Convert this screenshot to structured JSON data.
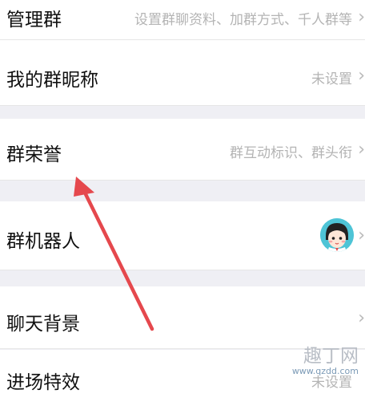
{
  "rows": {
    "manage": {
      "title": "管理群",
      "value": "设置群聊资料、加群方式、千人群等"
    },
    "nickname": {
      "title": "我的群昵称",
      "value": "未设置"
    },
    "honor": {
      "title": "群荣誉",
      "value": "群互动标识、群头衔"
    },
    "robot": {
      "title": "群机器人"
    },
    "background": {
      "title": "聊天背景"
    },
    "next": {
      "title": "进场特效",
      "value": "未设置"
    }
  },
  "icons": {
    "chevron": "›",
    "avatar": "robot-avatar-icon"
  },
  "watermark": {
    "text": "趣丁网",
    "url": "www.qzdd.com"
  },
  "colors": {
    "arrow": "#e5484d",
    "background": "#efeff4"
  }
}
